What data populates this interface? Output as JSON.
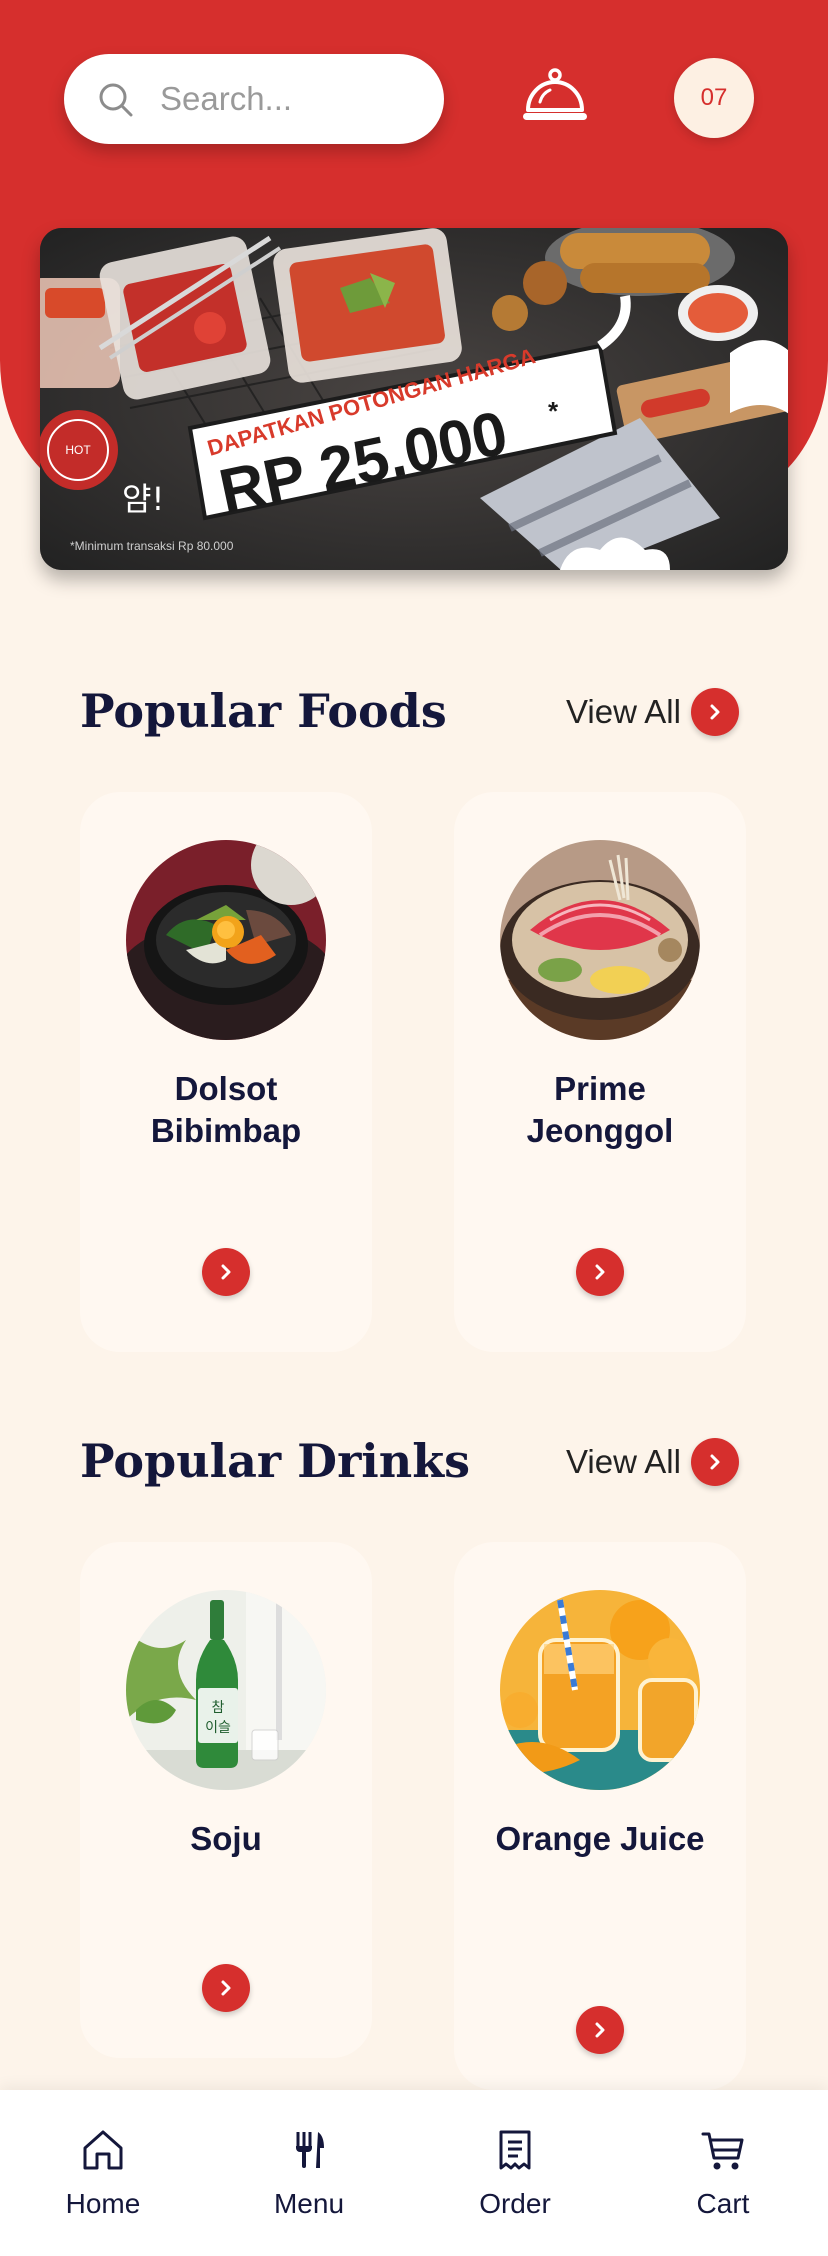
{
  "search": {
    "placeholder": "Search..."
  },
  "header": {
    "table_number": "07"
  },
  "banner": {
    "headline": "DAPATKAN POTONGAN HARGA",
    "amount": "RP 25.000",
    "asterisk": "*",
    "footnote": "*Minimum transaksi Rp 80.000",
    "korean": "얌!"
  },
  "popular_foods": {
    "title": "Popular Foods",
    "view_all": "View All",
    "items": [
      {
        "name": "Dolsot Bibimbap"
      },
      {
        "name": "Prime Jeonggol"
      }
    ]
  },
  "popular_drinks": {
    "title": "Popular Drinks",
    "view_all": "View All",
    "items": [
      {
        "name": "Soju"
      },
      {
        "name": "Orange Juice"
      }
    ]
  },
  "nav": {
    "items": [
      {
        "label": "Home",
        "icon": "home-icon"
      },
      {
        "label": "Menu",
        "icon": "utensils-icon"
      },
      {
        "label": "Order",
        "icon": "receipt-icon"
      },
      {
        "label": "Cart",
        "icon": "cart-icon"
      }
    ]
  },
  "colors": {
    "brand": "#d62f2d",
    "background": "#fdf4ea",
    "text": "#14173b"
  }
}
